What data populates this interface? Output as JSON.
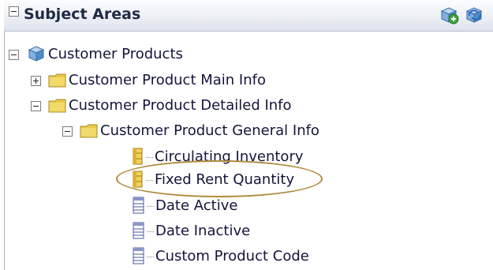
{
  "panel": {
    "title": "Subject Areas"
  },
  "tree": {
    "root": {
      "label": "Customer Products"
    },
    "main_info": {
      "label": "Customer Product Main Info"
    },
    "detailed_info": {
      "label": "Customer Product Detailed Info"
    },
    "general_info": {
      "label": "Customer Product General Info"
    },
    "columns": [
      {
        "label": "Circulating Inventory"
      },
      {
        "label": "Fixed Rent Quantity"
      },
      {
        "label": "Date Active"
      },
      {
        "label": "Date Inactive"
      },
      {
        "label": "Custom Product Code"
      }
    ]
  },
  "icons": [
    "expand-toggle-icon",
    "add-subject-area-icon",
    "refresh-icon",
    "cube-icon",
    "folder-icon",
    "measure-column-icon",
    "attribute-column-icon"
  ],
  "colors": {
    "folder": "#e9c84a",
    "measure": "#e6b93a",
    "attribute": "#8a96c8",
    "highlight": "#b08a3c"
  }
}
